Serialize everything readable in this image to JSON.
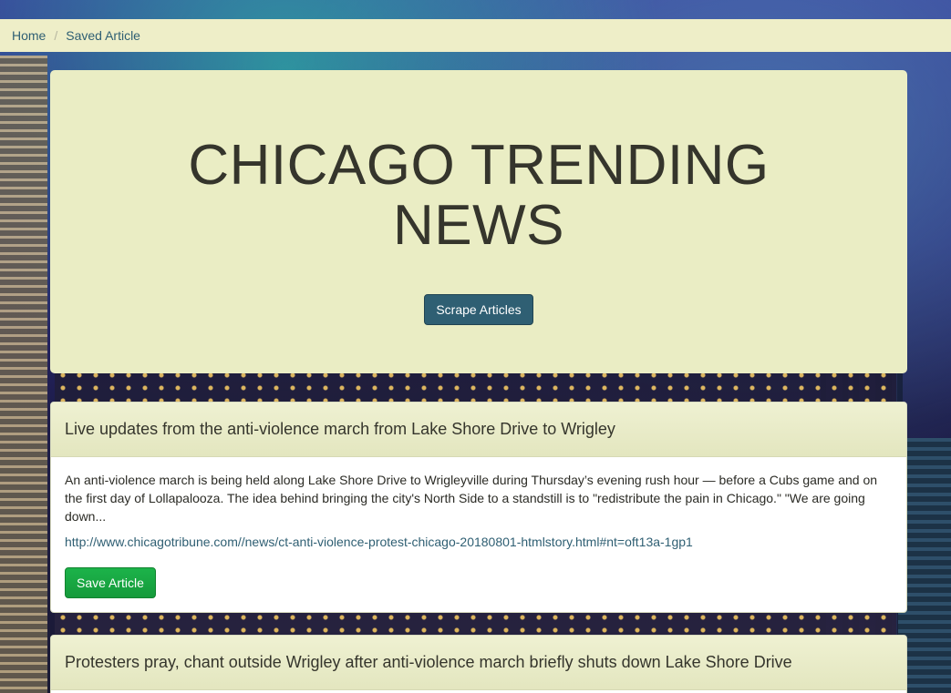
{
  "breadcrumb": {
    "home": "Home",
    "separator": "/",
    "current": "Saved Article"
  },
  "jumbotron": {
    "title": "CHICAGO TRENDING NEWS",
    "scrape_button": "Scrape Articles"
  },
  "articles": [
    {
      "headline": "Live updates from the anti-violence march from Lake Shore Drive to Wrigley",
      "summary": "An anti-violence march is being held along Lake Shore Drive to Wrigleyville during Thursday’s evening rush hour — before a Cubs game and on the first day of Lollapalooza. The idea behind bringing the city's North Side to a standstill is to \"redistribute the pain in Chicago.\" \"We are going down...",
      "link": "http://www.chicagotribune.com//news/ct-anti-violence-protest-chicago-20180801-htmlstory.html#nt=oft13a-1gp1",
      "save_button": "Save Article"
    },
    {
      "headline": "Protesters pray, chant outside Wrigley after anti-violence march briefly shuts down Lake Shore Drive"
    }
  ],
  "colors": {
    "primary_button": "#2f5f73",
    "save_button": "#1cb34a",
    "jumbotron_bg": "#eaedc4"
  }
}
